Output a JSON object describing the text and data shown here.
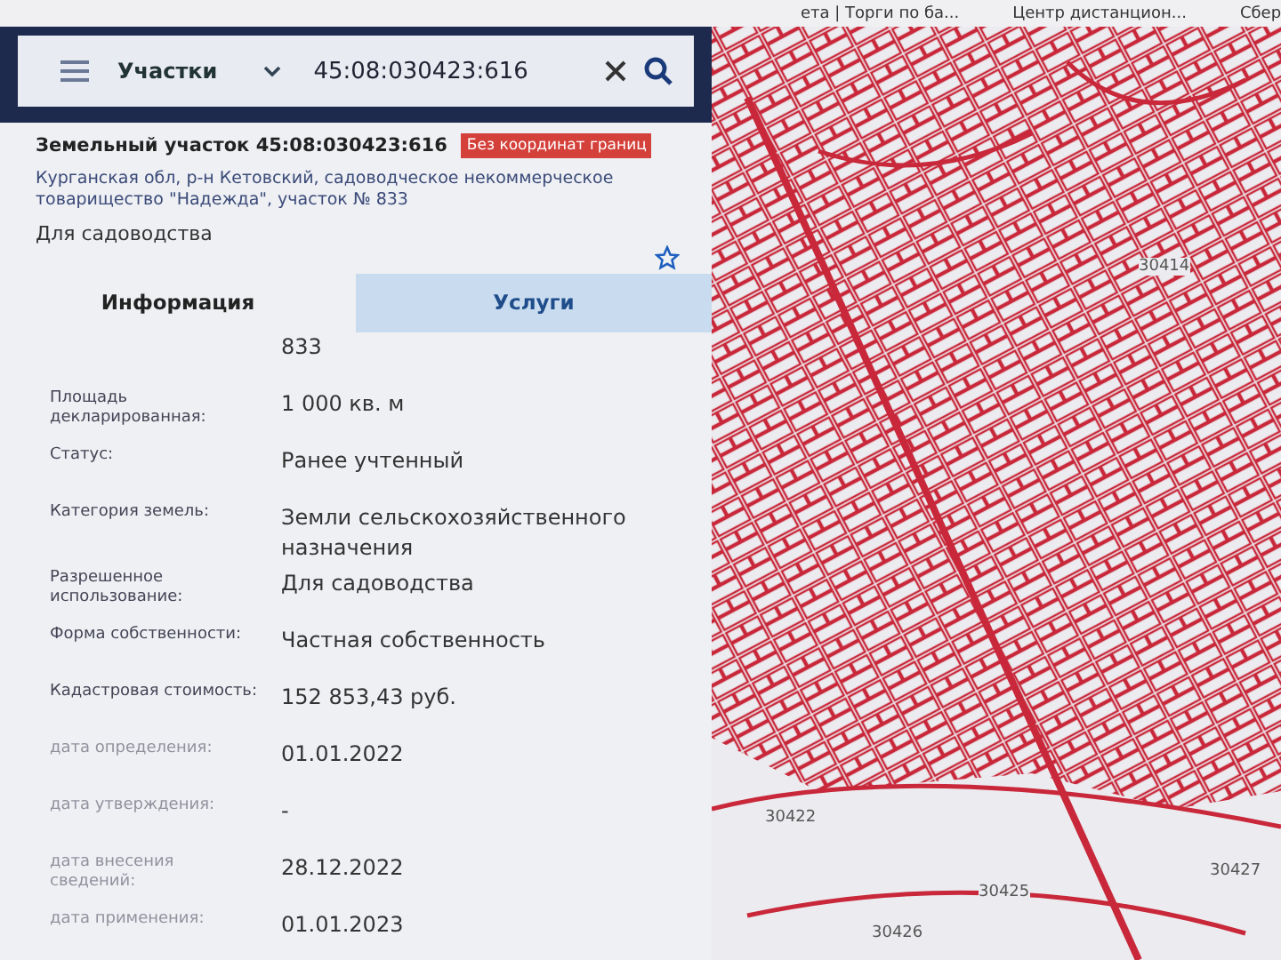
{
  "bookmarks": [
    {
      "label": "ета | Торги по ба..."
    },
    {
      "label": "Центр дистанцион..."
    },
    {
      "label": "Сбер"
    }
  ],
  "search": {
    "layer": "Участки",
    "value": "45:08:030423:616"
  },
  "parcel": {
    "title": "Земельный участок 45:08:030423:616",
    "badge": "Без координат границ",
    "address": "Курганская обл, р-н Кетовский, садоводческое некоммерческое товарищество \"Надежда\", участок № 833",
    "use": "Для садоводства",
    "favorite": false
  },
  "tabs": [
    {
      "label": "Информация",
      "selected": true
    },
    {
      "label": "Услуги",
      "selected": false
    }
  ],
  "fields": [
    {
      "value": "833"
    },
    {
      "label": "Площадь декларированная:",
      "value": "1 000 кв. м"
    },
    {
      "label": "Статус:",
      "value": "Ранее учтенный"
    },
    {
      "label": "Категория земель:",
      "value": "Земли сельскохозяйственного назначения"
    },
    {
      "label": "Разрешенное использование:",
      "value": "Для садоводства"
    },
    {
      "label": "Форма собственности:",
      "value": "Частная собственность"
    },
    {
      "label": "Кадастровая стоимость:",
      "value": "152 853,43 руб."
    },
    {
      "label": "дата определения:",
      "value": "01.01.2022"
    },
    {
      "label": "дата утверждения:",
      "value": "-"
    },
    {
      "label": "дата внесения сведений:",
      "value": "28.12.2022"
    },
    {
      "label": "дата применения:",
      "value": "01.01.2023"
    }
  ],
  "map": {
    "labels": [
      "30414",
      "30422",
      "30425",
      "30427",
      "30426"
    ]
  }
}
